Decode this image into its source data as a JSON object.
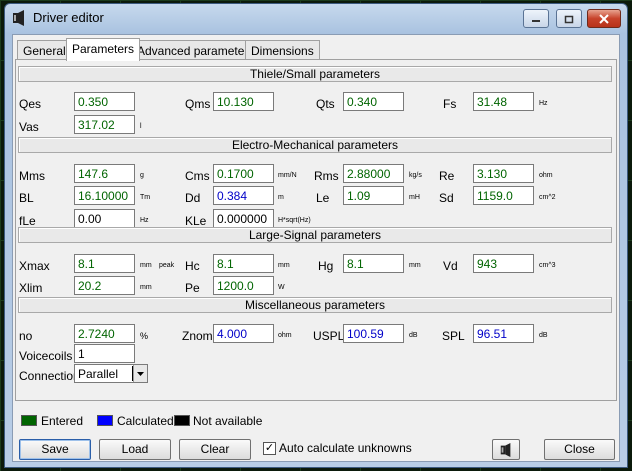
{
  "window": {
    "title": "Driver editor"
  },
  "tabs": [
    "General",
    "Parameters",
    "Advanced parameters",
    "Dimensions"
  ],
  "sections": {
    "thiele": "Thiele/Small parameters",
    "electro": "Electro-Mechanical parameters",
    "large": "Large-Signal parameters",
    "misc": "Miscellaneous parameters"
  },
  "params": {
    "qes": {
      "label": "Qes",
      "value": "0.350"
    },
    "qms": {
      "label": "Qms",
      "value": "10.130"
    },
    "qts": {
      "label": "Qts",
      "value": "0.340"
    },
    "fs": {
      "label": "Fs",
      "value": "31.48",
      "unit": "Hz"
    },
    "vas": {
      "label": "Vas",
      "value": "317.02",
      "unit": "l"
    },
    "mms": {
      "label": "Mms",
      "value": "147.6",
      "unit": "g"
    },
    "cms": {
      "label": "Cms",
      "value": "0.1700",
      "unit": "mm/N"
    },
    "rms": {
      "label": "Rms",
      "value": "2.88000",
      "unit": "kg/s"
    },
    "re": {
      "label": "Re",
      "value": "3.130",
      "unit": "ohm"
    },
    "bl": {
      "label": "BL",
      "value": "16.10000",
      "unit": "Tm"
    },
    "dd": {
      "label": "Dd",
      "value": "0.384",
      "unit": "m"
    },
    "le": {
      "label": "Le",
      "value": "1.09",
      "unit": "mH"
    },
    "sd": {
      "label": "Sd",
      "value": "1159.0",
      "unit": "cm^2"
    },
    "fle": {
      "label": "fLe",
      "value": "0.00",
      "unit": "Hz"
    },
    "kle": {
      "label": "KLe",
      "value": "0.000000",
      "unit": "H*sqrt(Hz)"
    },
    "xmax": {
      "label": "Xmax",
      "value": "8.1",
      "unit": "mm",
      "unit2": "peak"
    },
    "hc": {
      "label": "Hc",
      "value": "8.1",
      "unit": "mm"
    },
    "hg": {
      "label": "Hg",
      "value": "8.1",
      "unit": "mm"
    },
    "vd": {
      "label": "Vd",
      "value": "943",
      "unit": "cm^3"
    },
    "xlim": {
      "label": "Xlim",
      "value": "20.2",
      "unit": "mm"
    },
    "pe": {
      "label": "Pe",
      "value": "1200.0",
      "unit": "W"
    },
    "no": {
      "label": "no",
      "value": "2.7240",
      "unit": "%"
    },
    "znom": {
      "label": "Znom",
      "value": "4.000",
      "unit": "ohm"
    },
    "uspl": {
      "label": "USPL",
      "value": "100.59",
      "unit": "dB"
    },
    "spl": {
      "label": "SPL",
      "value": "96.51",
      "unit": "dB"
    },
    "voicecoils": {
      "label": "Voicecoils",
      "value": "1"
    },
    "connection": {
      "label": "Connection",
      "value": "Parallel"
    }
  },
  "legend": {
    "entered": {
      "label": "Entered",
      "color": "#006400"
    },
    "calculated": {
      "label": "Calculated",
      "color": "#0000ff"
    },
    "na": {
      "label": "Not available",
      "color": "#000000"
    }
  },
  "buttons": {
    "save": "Save",
    "load": "Load",
    "clear": "Clear",
    "close": "Close"
  },
  "auto_calc": {
    "label": "Auto calculate unknowns",
    "checked": true,
    "mark": "✓"
  },
  "icons": {
    "window": "speaker-icon",
    "toolbar": "speaker-icon"
  }
}
